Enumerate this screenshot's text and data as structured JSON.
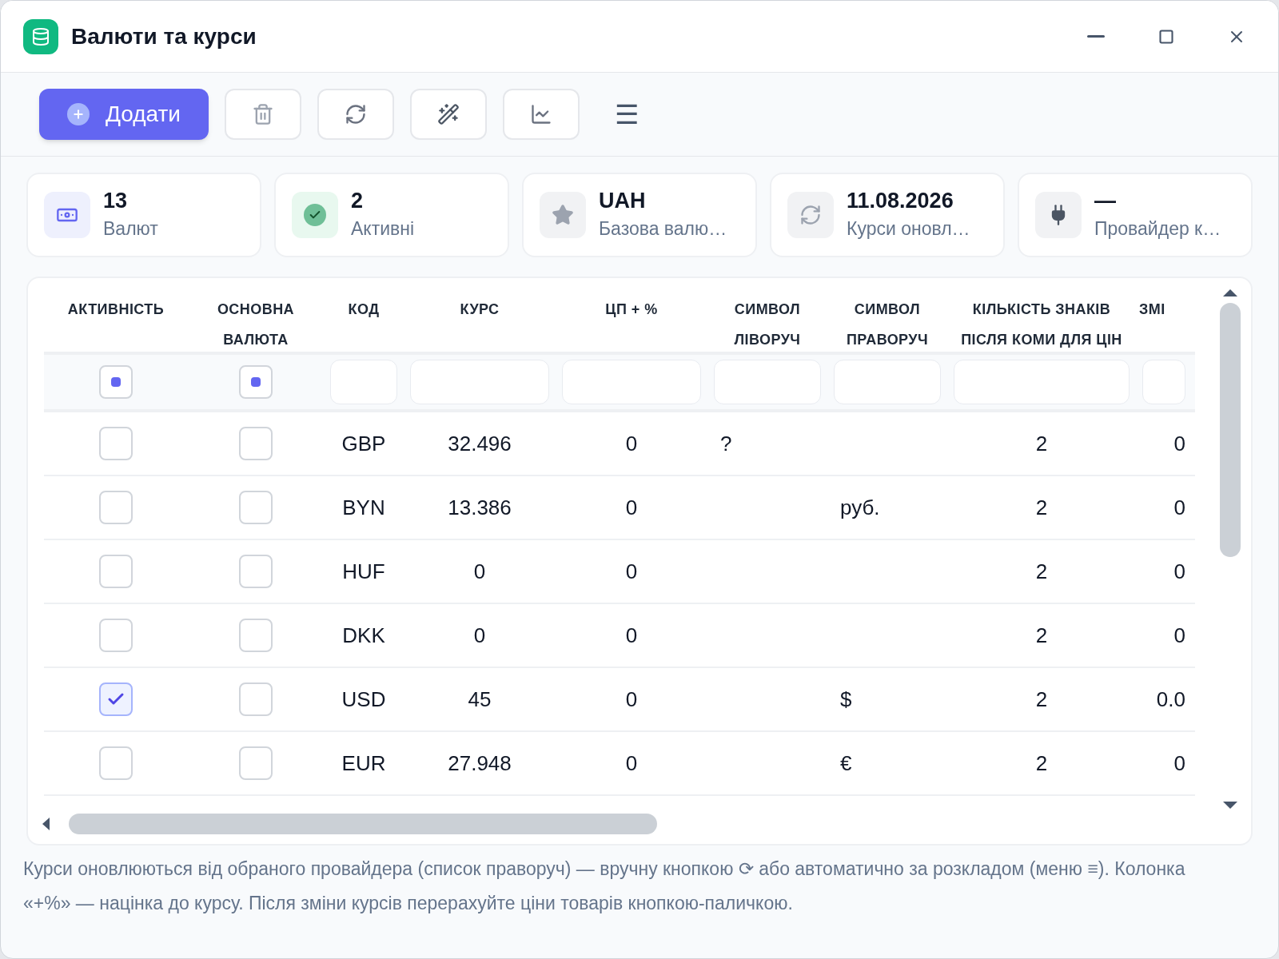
{
  "window": {
    "title": "Валюти та курси"
  },
  "toolbar": {
    "add_button": "Додати",
    "menu_glyph": "☰"
  },
  "stats": [
    {
      "kind": "money",
      "value": "13",
      "label": "Валют"
    },
    {
      "kind": "check",
      "value": "2",
      "label": "Активні"
    },
    {
      "kind": "star",
      "value": "UAH",
      "label": "Базова валю…"
    },
    {
      "kind": "refresh",
      "value": "11.08.2026",
      "label": "Курси оновл…"
    },
    {
      "kind": "plug",
      "value": "—",
      "label": "Провайдер к…"
    }
  ],
  "table": {
    "columns": [
      "АКТИВНІСТЬ",
      "ОСНОВНА ВАЛЮТА",
      "КОД",
      "КУРС",
      "ЦП + %",
      "СИМВОЛ ЛІВОРУЧ",
      "СИМВОЛ ПРАВОРУЧ",
      "КІЛЬКІСТЬ ЗНАКІВ ПІСЛЯ КОМИ ДЛЯ ЦІН",
      "ЗМІ"
    ],
    "filters": [
      {
        "kind": "checkbox",
        "indeterminate": true
      },
      {
        "kind": "checkbox",
        "indeterminate": true
      },
      {
        "kind": "field"
      },
      {
        "kind": "field"
      },
      {
        "kind": "field"
      },
      {
        "kind": "field"
      },
      {
        "kind": "field"
      },
      {
        "kind": "field"
      },
      {
        "kind": "field"
      }
    ],
    "rows": [
      {
        "active": false,
        "main": false,
        "code": "GBP",
        "rate": "32.496",
        "markup": "0",
        "symbol_left": "?",
        "symbol_right": "",
        "decimals": "2",
        "column_9": "0"
      },
      {
        "active": false,
        "main": false,
        "code": "BYN",
        "rate": "13.386",
        "markup": "0",
        "symbol_left": "",
        "symbol_right": "руб.",
        "decimals": "2",
        "column_9": "0"
      },
      {
        "active": false,
        "main": false,
        "code": "HUF",
        "rate": "0",
        "markup": "0",
        "symbol_left": "",
        "symbol_right": "",
        "decimals": "2",
        "column_9": "0"
      },
      {
        "active": false,
        "main": false,
        "code": "DKK",
        "rate": "0",
        "markup": "0",
        "symbol_left": "",
        "symbol_right": "",
        "decimals": "2",
        "column_9": "0"
      },
      {
        "active": true,
        "main": false,
        "code": "USD",
        "rate": "45",
        "markup": "0",
        "symbol_left": "",
        "symbol_right": "$",
        "decimals": "2",
        "column_9": "0.0"
      },
      {
        "active": false,
        "main": false,
        "code": "EUR",
        "rate": "27.948",
        "markup": "0",
        "symbol_left": "",
        "symbol_right": "€",
        "decimals": "2",
        "column_9": "0"
      }
    ]
  },
  "footer_note": "Курси оновлюються від обраного провайдера (список праворуч) — вручну кнопкою ⟳ або автоматично за розкладом (меню ≡). Колонка «+%» — націнка до курсу. Після зміни курсів перерахуйте ціни товарів кнопкою-паличкою."
}
